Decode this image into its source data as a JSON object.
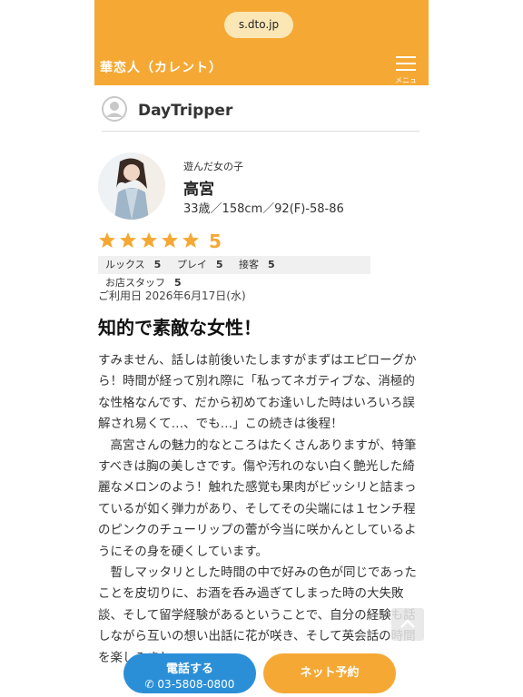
{
  "browser": {
    "url": "s.dto.jp"
  },
  "header": {
    "site_title": "華恋人（カレント）",
    "menu_label": "メニュー"
  },
  "reviewer": {
    "name": "DayTripper"
  },
  "girl": {
    "caption": "遊んだ女の子",
    "name": "高宮",
    "stats": "33歳／158cm／92(F)-58-86"
  },
  "rating": {
    "stars": 5,
    "score": "5",
    "star_color": "#f5a934",
    "sub_scores": [
      {
        "label": "ルックス",
        "value": "5"
      },
      {
        "label": "プレイ",
        "value": "5"
      },
      {
        "label": "接客",
        "value": "5"
      },
      {
        "label": "お店スタッフ",
        "value": "5"
      }
    ]
  },
  "review": {
    "visit_date": "ご利用日 2026年6月17日(水)",
    "title": "知的で素敵な女性！",
    "body": "すみません、話しは前後いたしますがまずはエピローグから！時間が経って別れ際に「私ってネガティブな、消極的な性格なんです、だから初めてお逢いした時はいろいろ誤解され易くて…、でも…」この続きは後程！\n　高宮さんの魅力的なところはたくさんありますが、特筆すべきは胸の美しさです。傷や汚れのない白く艶光した綺麗なメロンのよう！触れた感覚も果肉がビッシリと詰まっているが如く弾力があり、そしてその尖端には１センチ程のピンクのチューリップの蕾が今当に咲かんとしているようにその身を硬くしています。\n　暫しマッタリとした時間の中で好みの色が同じであったことを皮切りに、お酒を呑み過ぎてしまった時の大失敗談、そして留学経験があるということで、自分の経験も話しながら互いの想い出話に花が咲き、そして英会話の時間を楽しみまし"
  },
  "cta": {
    "call_label": "電話する",
    "call_number": "03-5808-0800",
    "net_label": "ネット予約"
  },
  "colors": {
    "accent": "#f5a934",
    "call": "#2b8fd8"
  }
}
